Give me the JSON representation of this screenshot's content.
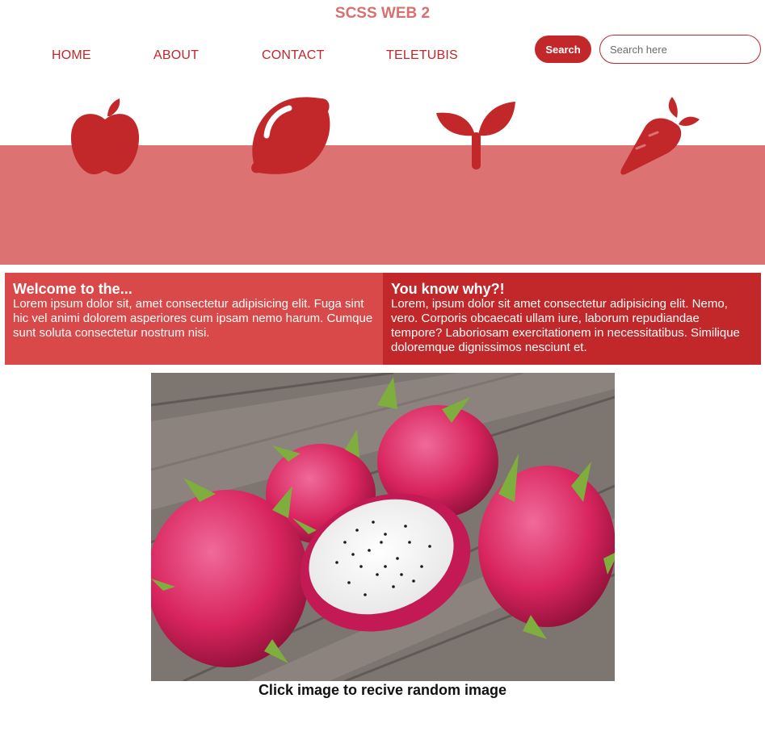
{
  "header": {
    "title": "SCSS WEB 2"
  },
  "nav": {
    "items": [
      {
        "label": "HOME"
      },
      {
        "label": "ABOUT"
      },
      {
        "label": "CONTACT"
      },
      {
        "label": "TELETUBIS"
      }
    ]
  },
  "search": {
    "button_label": "Search",
    "placeholder": "Search here",
    "value": ""
  },
  "hero": {
    "icons": [
      "apple-icon",
      "lemon-icon",
      "seedling-icon",
      "carrot-icon"
    ]
  },
  "panels": {
    "left": {
      "heading": "Welcome to the...",
      "text": "Lorem ipsum dolor sit, amet consectetur adipisicing elit. Fuga sint hic vel animi dolorem asperiores cum ipsam nemo harum. Cumque sunt soluta consectetur nostrum nisi."
    },
    "right": {
      "heading": "You know why?!",
      "text": "Lorem, ipsum dolor sit amet consectetur adipisicing elit. Nemo, vero. Corporis obcaecati ullam iure, laborum repudiandae tempore? Laboriosam exercitationem in necessitatibus. Similique doloremque dignissimos nesciunt et."
    }
  },
  "image": {
    "subject": "dragon-fruit-photo",
    "caption": "Click image to recive random image"
  },
  "colors": {
    "primary": "#c2272a",
    "title": "#d87070",
    "band": "#dc7372",
    "panel_left": "#d9494a",
    "panel_right": "#c2272a"
  }
}
